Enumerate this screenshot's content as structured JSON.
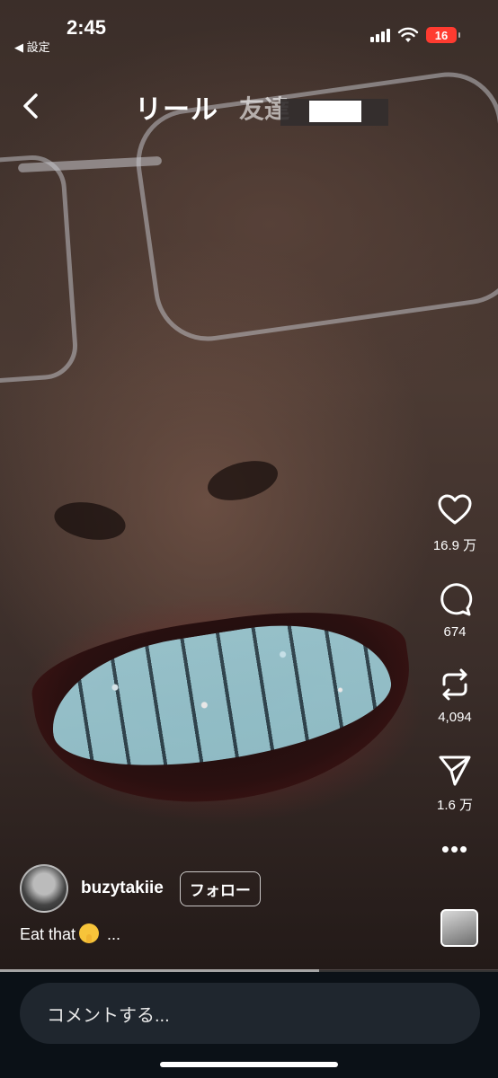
{
  "status": {
    "time": "2:45",
    "back_label": "◀ 設定",
    "battery": "16"
  },
  "header": {
    "title": "リール",
    "friends_tab": "友達"
  },
  "actions": {
    "likes": "16.9 万",
    "comments": "674",
    "reposts": "4,094",
    "shares": "1.6 万",
    "more": "•••"
  },
  "post": {
    "username": "buzytakiie",
    "follow_label": "フォロー",
    "caption_text": "Eat that",
    "caption_more": " ..."
  },
  "progress": {
    "played_fraction": 0.64
  },
  "comment": {
    "placeholder": "コメントする..."
  },
  "colors": {
    "battery": "#ff3b30",
    "bottom_bar": "#0b1117",
    "comment_field": "#1f262e"
  },
  "icons": [
    "chevron-left-icon",
    "wifi-icon",
    "heart-icon",
    "comment-bubble-icon",
    "repost-icon",
    "send-icon",
    "more-icon",
    "shushing-emoji-icon"
  ]
}
